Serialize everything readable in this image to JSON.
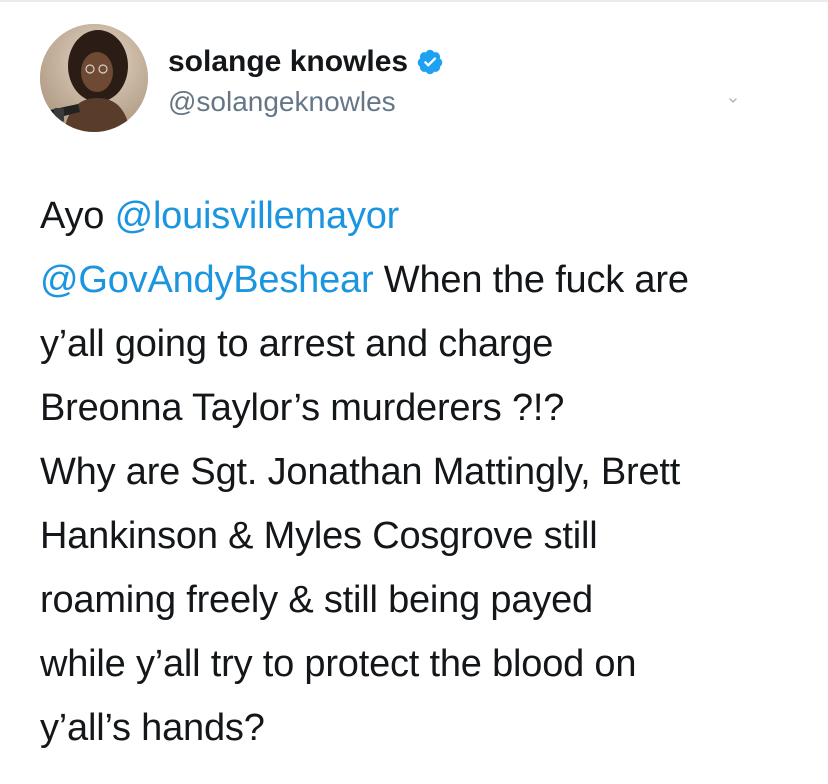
{
  "author": {
    "display_name": "solange knowles",
    "handle": "@solangeknowles",
    "verified": true,
    "avatar_icon": "profile-photo",
    "verified_icon": "verified-badge-icon"
  },
  "tweet": {
    "lines": [
      {
        "parts": [
          {
            "text": "Ayo ",
            "type": "text"
          },
          {
            "text": "@louisvillemayor",
            "type": "mention"
          }
        ]
      },
      {
        "parts": [
          {
            "text": "@GovAndyBeshear",
            "type": "mention"
          },
          {
            "text": " When the fuck are",
            "type": "text"
          }
        ]
      },
      {
        "parts": [
          {
            "text": "y’all going to arrest and charge",
            "type": "text"
          }
        ]
      },
      {
        "parts": [
          {
            "text": "Breonna Taylor’s murderers ?!?",
            "type": "text"
          }
        ]
      },
      {
        "parts": [
          {
            "text": "Why are Sgt. Jonathan Mattingly, Brett",
            "type": "text"
          }
        ]
      },
      {
        "parts": [
          {
            "text": "Hankinson & Myles Cosgrove still",
            "type": "text"
          }
        ]
      },
      {
        "parts": [
          {
            "text": "roaming freely & still being payed",
            "type": "text"
          }
        ]
      },
      {
        "parts": [
          {
            "text": "while y’all try to protect the blood on",
            "type": "text"
          }
        ]
      },
      {
        "parts": [
          {
            "text": "y’all’s hands?",
            "type": "text"
          }
        ]
      }
    ]
  },
  "colors": {
    "text": "#14171a",
    "secondary": "#657786",
    "link": "#1b95e0",
    "verified": "#1da1f2"
  }
}
